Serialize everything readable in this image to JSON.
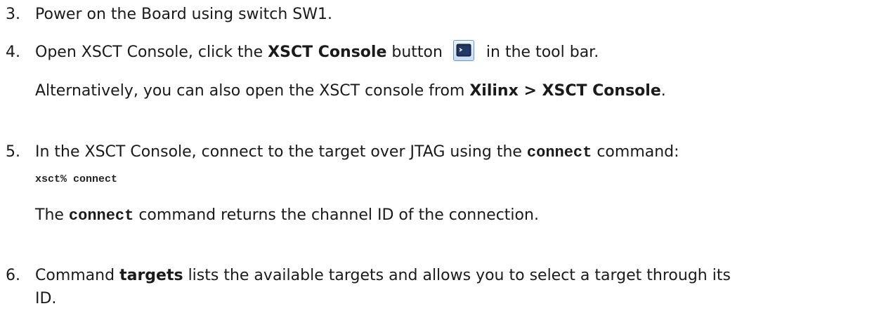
{
  "steps": [
    {
      "number": "3.",
      "text_a": "Power on the Board using switch SW1."
    },
    {
      "number": "4.",
      "text_a": "Open XSCT Console, click the ",
      "bold_a": "XSCT Console",
      "text_b": " button ",
      "icon": "xsct-console-terminal-icon",
      "text_c": " in the tool bar.",
      "note_a": "Alternatively, you can also open the XSCT console from ",
      "note_bold_a": "Xilinx > XSCT Console",
      "note_b": "."
    },
    {
      "number": "5.",
      "text_a": "In the XSCT Console, connect to the target over JTAG using the ",
      "code_a": "connect",
      "text_b": " command:",
      "code_block": "xsct% connect",
      "note_a": "The ",
      "note_code": "connect",
      "note_b": " command returns the channel ID of the connection."
    },
    {
      "number": "6.",
      "text_a": "Command ",
      "bold_a": "targets",
      "text_b": " lists the available targets and allows you to select a target through its",
      "text_c": "ID."
    }
  ]
}
